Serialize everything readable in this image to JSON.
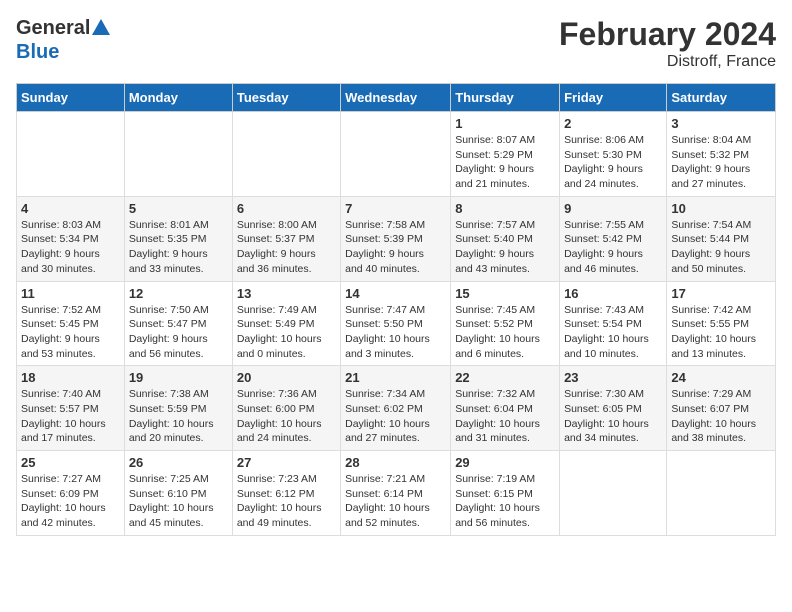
{
  "header": {
    "logo_general": "General",
    "logo_blue": "Blue",
    "title": "February 2024",
    "subtitle": "Distroff, France"
  },
  "columns": [
    "Sunday",
    "Monday",
    "Tuesday",
    "Wednesday",
    "Thursday",
    "Friday",
    "Saturday"
  ],
  "weeks": [
    [
      {
        "day": "",
        "detail": ""
      },
      {
        "day": "",
        "detail": ""
      },
      {
        "day": "",
        "detail": ""
      },
      {
        "day": "",
        "detail": ""
      },
      {
        "day": "1",
        "detail": "Sunrise: 8:07 AM\nSunset: 5:29 PM\nDaylight: 9 hours\nand 21 minutes."
      },
      {
        "day": "2",
        "detail": "Sunrise: 8:06 AM\nSunset: 5:30 PM\nDaylight: 9 hours\nand 24 minutes."
      },
      {
        "day": "3",
        "detail": "Sunrise: 8:04 AM\nSunset: 5:32 PM\nDaylight: 9 hours\nand 27 minutes."
      }
    ],
    [
      {
        "day": "4",
        "detail": "Sunrise: 8:03 AM\nSunset: 5:34 PM\nDaylight: 9 hours\nand 30 minutes."
      },
      {
        "day": "5",
        "detail": "Sunrise: 8:01 AM\nSunset: 5:35 PM\nDaylight: 9 hours\nand 33 minutes."
      },
      {
        "day": "6",
        "detail": "Sunrise: 8:00 AM\nSunset: 5:37 PM\nDaylight: 9 hours\nand 36 minutes."
      },
      {
        "day": "7",
        "detail": "Sunrise: 7:58 AM\nSunset: 5:39 PM\nDaylight: 9 hours\nand 40 minutes."
      },
      {
        "day": "8",
        "detail": "Sunrise: 7:57 AM\nSunset: 5:40 PM\nDaylight: 9 hours\nand 43 minutes."
      },
      {
        "day": "9",
        "detail": "Sunrise: 7:55 AM\nSunset: 5:42 PM\nDaylight: 9 hours\nand 46 minutes."
      },
      {
        "day": "10",
        "detail": "Sunrise: 7:54 AM\nSunset: 5:44 PM\nDaylight: 9 hours\nand 50 minutes."
      }
    ],
    [
      {
        "day": "11",
        "detail": "Sunrise: 7:52 AM\nSunset: 5:45 PM\nDaylight: 9 hours\nand 53 minutes."
      },
      {
        "day": "12",
        "detail": "Sunrise: 7:50 AM\nSunset: 5:47 PM\nDaylight: 9 hours\nand 56 minutes."
      },
      {
        "day": "13",
        "detail": "Sunrise: 7:49 AM\nSunset: 5:49 PM\nDaylight: 10 hours\nand 0 minutes."
      },
      {
        "day": "14",
        "detail": "Sunrise: 7:47 AM\nSunset: 5:50 PM\nDaylight: 10 hours\nand 3 minutes."
      },
      {
        "day": "15",
        "detail": "Sunrise: 7:45 AM\nSunset: 5:52 PM\nDaylight: 10 hours\nand 6 minutes."
      },
      {
        "day": "16",
        "detail": "Sunrise: 7:43 AM\nSunset: 5:54 PM\nDaylight: 10 hours\nand 10 minutes."
      },
      {
        "day": "17",
        "detail": "Sunrise: 7:42 AM\nSunset: 5:55 PM\nDaylight: 10 hours\nand 13 minutes."
      }
    ],
    [
      {
        "day": "18",
        "detail": "Sunrise: 7:40 AM\nSunset: 5:57 PM\nDaylight: 10 hours\nand 17 minutes."
      },
      {
        "day": "19",
        "detail": "Sunrise: 7:38 AM\nSunset: 5:59 PM\nDaylight: 10 hours\nand 20 minutes."
      },
      {
        "day": "20",
        "detail": "Sunrise: 7:36 AM\nSunset: 6:00 PM\nDaylight: 10 hours\nand 24 minutes."
      },
      {
        "day": "21",
        "detail": "Sunrise: 7:34 AM\nSunset: 6:02 PM\nDaylight: 10 hours\nand 27 minutes."
      },
      {
        "day": "22",
        "detail": "Sunrise: 7:32 AM\nSunset: 6:04 PM\nDaylight: 10 hours\nand 31 minutes."
      },
      {
        "day": "23",
        "detail": "Sunrise: 7:30 AM\nSunset: 6:05 PM\nDaylight: 10 hours\nand 34 minutes."
      },
      {
        "day": "24",
        "detail": "Sunrise: 7:29 AM\nSunset: 6:07 PM\nDaylight: 10 hours\nand 38 minutes."
      }
    ],
    [
      {
        "day": "25",
        "detail": "Sunrise: 7:27 AM\nSunset: 6:09 PM\nDaylight: 10 hours\nand 42 minutes."
      },
      {
        "day": "26",
        "detail": "Sunrise: 7:25 AM\nSunset: 6:10 PM\nDaylight: 10 hours\nand 45 minutes."
      },
      {
        "day": "27",
        "detail": "Sunrise: 7:23 AM\nSunset: 6:12 PM\nDaylight: 10 hours\nand 49 minutes."
      },
      {
        "day": "28",
        "detail": "Sunrise: 7:21 AM\nSunset: 6:14 PM\nDaylight: 10 hours\nand 52 minutes."
      },
      {
        "day": "29",
        "detail": "Sunrise: 7:19 AM\nSunset: 6:15 PM\nDaylight: 10 hours\nand 56 minutes."
      },
      {
        "day": "",
        "detail": ""
      },
      {
        "day": "",
        "detail": ""
      }
    ]
  ]
}
